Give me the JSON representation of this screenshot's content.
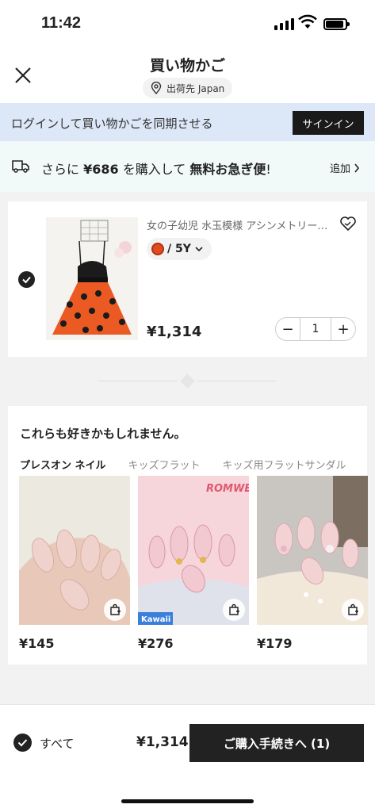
{
  "status_bar": {
    "time": "11:42"
  },
  "header": {
    "title": "買い物かご",
    "ship_to": "出荷先 Japan"
  },
  "signin_banner": {
    "text": "ログインして買い物かごを同期させる",
    "button": "サインイン"
  },
  "shipping_banner": {
    "prefix": "さらに",
    "amount": "¥686",
    "middle": "を購入して",
    "highlight": "無料お急ぎ便",
    "suffix": "!",
    "action": "追加"
  },
  "cart_item": {
    "name": "女の子幼児 水玉模様 アシンメトリー裾 ワンピース",
    "variant": "/ 5Y",
    "price": "¥1,314",
    "quantity": "1",
    "selected": true
  },
  "recommendations": {
    "title": "これらも好きかもしれません。",
    "tabs": [
      "プレスオン ネイル",
      "キッズフラット",
      "キッズ用フラットサンダル"
    ],
    "active_tab": 0,
    "products": [
      {
        "price": "¥145"
      },
      {
        "price": "¥276",
        "brand": "ROMWE",
        "badge": "Kawaii"
      },
      {
        "price": "¥179"
      }
    ]
  },
  "footer": {
    "select_all": "すべて",
    "total": "¥1,314",
    "checkout": "ご購入手続きへ (1)"
  },
  "colors": {
    "signin_bg": "#dce7f7",
    "shipping_bg": "#f1f9f9",
    "dark": "#222222",
    "dress_orange": "#e04b1f"
  }
}
